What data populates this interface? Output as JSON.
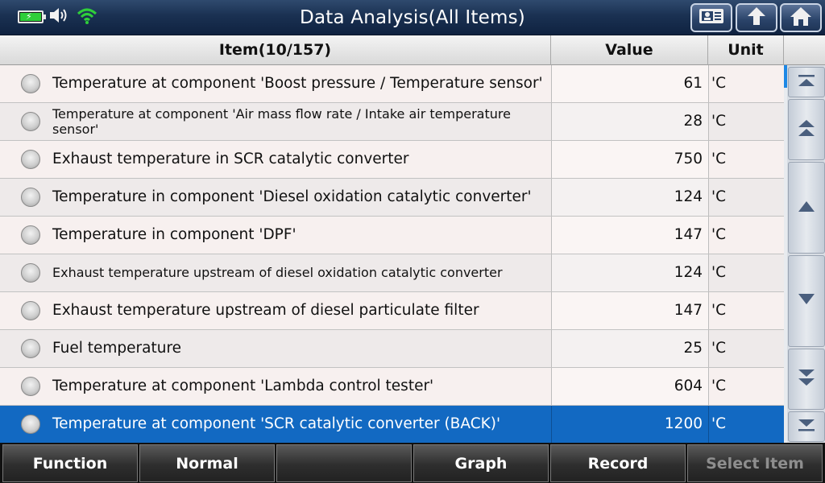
{
  "status_icons": [
    "battery-charging-icon",
    "speaker-icon",
    "wifi-icon"
  ],
  "title": "Data Analysis(All Items)",
  "top_buttons": [
    "report-icon",
    "back-arrow-icon",
    "home-icon"
  ],
  "table": {
    "headers": {
      "item": "Item(10/157)",
      "value": "Value",
      "unit": "Unit"
    },
    "rows": [
      {
        "name": "Temperature at component 'Boost pressure / Temperature sensor'",
        "value": "61",
        "unit": "'C"
      },
      {
        "name": "Temperature at component 'Air mass flow rate / Intake air temperature sensor'",
        "value": "28",
        "unit": "'C"
      },
      {
        "name": "Exhaust temperature in SCR catalytic converter",
        "value": "750",
        "unit": "'C"
      },
      {
        "name": "Temperature in component 'Diesel oxidation catalytic converter'",
        "value": "124",
        "unit": "'C"
      },
      {
        "name": "Temperature in component 'DPF'",
        "value": "147",
        "unit": "'C"
      },
      {
        "name": "Exhaust temperature upstream of diesel oxidation catalytic converter",
        "value": "124",
        "unit": "'C"
      },
      {
        "name": "Exhaust temperature upstream of diesel particulate filter",
        "value": "147",
        "unit": "'C"
      },
      {
        "name": "Fuel temperature",
        "value": "25",
        "unit": "'C"
      },
      {
        "name": "Temperature at component 'Lambda control tester'",
        "value": "604",
        "unit": "'C"
      },
      {
        "name": "Temperature at component 'SCR catalytic converter (BACK)'",
        "value": "1200",
        "unit": "'C"
      }
    ],
    "selected_row": 9
  },
  "scroll_buttons": [
    "scroll-top-icon",
    "page-up-icon",
    "line-up-icon",
    "line-down-icon",
    "page-down-icon",
    "scroll-bottom-icon"
  ],
  "bottom_bar": {
    "function": "Function",
    "normal": "Normal",
    "empty": "",
    "graph": "Graph",
    "record": "Record",
    "select_item": "Select Item"
  },
  "colors": {
    "selected_row": "#1269c2",
    "topbar": "#1a3152",
    "wifi": "#2fcf3a"
  }
}
